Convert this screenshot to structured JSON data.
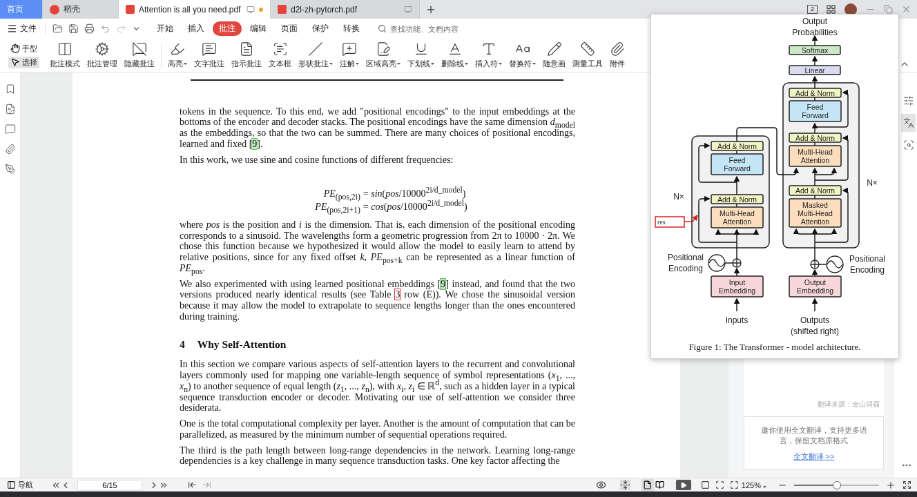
{
  "tabs": [
    {
      "kind": "home",
      "label": "首页",
      "selected": false,
      "unsaved": false
    },
    {
      "kind": "app",
      "label": "稻壳",
      "selected": false,
      "unsaved": false
    },
    {
      "kind": "pdf",
      "label": "Attention is all you need.pdf",
      "selected": true,
      "unsaved": true
    },
    {
      "kind": "pdf",
      "label": "d2l-zh-pytorch.pdf",
      "selected": false,
      "unsaved": false
    }
  ],
  "window_controls": {
    "screen_count": "2"
  },
  "menu": {
    "file": "文件",
    "search_placeholder": "查找功能、文档内容",
    "tabs": [
      {
        "label": "开始",
        "selected": false
      },
      {
        "label": "插入",
        "selected": false
      },
      {
        "label": "批注",
        "selected": true
      },
      {
        "label": "编辑",
        "selected": false
      },
      {
        "label": "页面",
        "selected": false
      },
      {
        "label": "保护",
        "selected": false
      },
      {
        "label": "转换",
        "selected": false
      }
    ]
  },
  "modes": [
    {
      "kind": "hand",
      "label": "手型",
      "selected": false
    },
    {
      "kind": "select",
      "label": "选择",
      "selected": true
    }
  ],
  "tools": [
    {
      "label": "批注模式",
      "dropdown": false
    },
    {
      "label": "批注管理",
      "dropdown": false
    },
    {
      "label": "隐藏批注",
      "dropdown": false
    },
    {
      "label": "高亮",
      "dropdown": true
    },
    {
      "label": "文字批注",
      "dropdown": false
    },
    {
      "label": "指示批注",
      "dropdown": false
    },
    {
      "label": "文本框",
      "dropdown": false
    },
    {
      "label": "形状批注",
      "dropdown": true
    },
    {
      "label": "注解",
      "dropdown": true
    },
    {
      "label": "区域高亮",
      "dropdown": true
    },
    {
      "label": "下划线",
      "dropdown": true
    },
    {
      "label": "删除线",
      "dropdown": true
    },
    {
      "label": "插入符",
      "dropdown": true
    },
    {
      "label": "替换符",
      "dropdown": true
    },
    {
      "label": "随意画",
      "dropdown": false
    },
    {
      "label": "测量工具",
      "dropdown": false
    },
    {
      "label": "附件",
      "dropdown": false
    }
  ],
  "document": {
    "blocks": [
      {
        "kind": "paragraph",
        "parts": [
          {
            "kind": "text",
            "text": "tokens in the sequence. To this end, we add \"positional encodings\" to the input embeddings at the bottoms of the encoder and decoder stacks. The positional encodings have the same dimension *d*$_{model}$ as the embeddings, so that the two can be summed. There are many choices of positional encodings, learned and fixed ["
          },
          {
            "kind": "cite",
            "text": "9"
          },
          {
            "kind": "text",
            "text": "]."
          }
        ]
      },
      {
        "kind": "paragraph",
        "parts": [
          {
            "kind": "text",
            "text": "In this work, we use sine and cosine functions of different frequencies:"
          }
        ]
      },
      {
        "kind": "formula",
        "rows": [
          {
            "lhs": "*PE*$_{(pos,2i)}$",
            "rhs": "= *sin*(*pos*/10000$^{2i/d_model}$)"
          },
          {
            "lhs": "*PE*$_{(pos,2i+1)}$",
            "rhs": "= *cos*(*pos*/10000$^{2i/d_model}$)"
          }
        ]
      },
      {
        "kind": "paragraph",
        "parts": [
          {
            "kind": "text",
            "text": "where *pos* is the position and *i* is the dimension. That is, each dimension of the positional encoding corresponds to a sinusoid. The wavelengths form a geometric progression from 2π to 10000 · 2π. We chose this function because we hypothesized it would allow the model to easily learn to attend by relative positions, since for any fixed offset *k*, *PE*$_{pos+k}$ can be represented as a linear function of *PE*$_{pos}$."
          }
        ]
      },
      {
        "kind": "paragraph",
        "parts": [
          {
            "kind": "text",
            "text": "We also experimented with using learned positional embeddings ["
          },
          {
            "kind": "cite",
            "text": "9"
          },
          {
            "kind": "text",
            "text": "] instead, and found that the two versions produced nearly identical results (see Table "
          },
          {
            "kind": "ref",
            "text": "3"
          },
          {
            "kind": "text",
            "text": " row (E)). We chose the sinusoidal version because it may allow the model to extrapolate to sequence lengths longer than the ones encountered during training."
          }
        ]
      },
      {
        "kind": "heading",
        "number": "4",
        "title": "Why Self-Attention"
      },
      {
        "kind": "paragraph",
        "parts": [
          {
            "kind": "text",
            "text": "In this section we compare various aspects of self-attention layers to the recurrent and convolutional layers commonly used for mapping one variable-length sequence of symbol representations (*x*$_{1}$, ..., *x*$_{n}$) to another sequence of equal length (*z*$_{1}$, ..., *z*$_{n}$), with *x*$_{i}$, *z*$_{i}$ ∈ ℝ$^{d}$, such as a hidden layer in a typical sequence transduction encoder or decoder. Motivating our use of self-attention we consider three desiderata."
          }
        ]
      },
      {
        "kind": "paragraph",
        "parts": [
          {
            "kind": "text",
            "text": "One is the total computational complexity per layer. Another is the amount of computation that can be parallelized, as measured by the minimum number of sequential operations required."
          }
        ]
      },
      {
        "kind": "paragraph",
        "parts": [
          {
            "kind": "text",
            "text": "The third is the path length between long-range dependencies in the network. Learning long-range dependencies is a key challenge in many sequence transduction tasks. One key factor affecting the"
          }
        ]
      }
    ]
  },
  "figure": {
    "blocks": [
      {
        "kind": "softmax",
        "lines": [
          "Softmax"
        ]
      },
      {
        "kind": "linear",
        "lines": [
          "Linear"
        ]
      },
      {
        "kind": "add_norm",
        "lines": [
          "Add & Norm"
        ]
      },
      {
        "kind": "feed_forward",
        "lines": [
          "Feed",
          "Forward"
        ]
      },
      {
        "kind": "add_norm",
        "lines": [
          "Add & Norm"
        ]
      },
      {
        "kind": "add_norm",
        "lines": [
          "Add & Norm"
        ]
      },
      {
        "kind": "attention",
        "lines": [
          "Multi-Head",
          "Attention"
        ]
      },
      {
        "kind": "feed_forward",
        "lines": [
          "Feed",
          "Forward"
        ]
      },
      {
        "kind": "add_norm",
        "lines": [
          "Add & Norm"
        ]
      },
      {
        "kind": "add_norm",
        "lines": [
          "Add & Norm"
        ]
      },
      {
        "kind": "attention",
        "lines": [
          "Multi-Head",
          "Attention"
        ]
      },
      {
        "kind": "attention",
        "lines": [
          "Masked",
          "Multi-Head",
          "Attention"
        ]
      },
      {
        "kind": "embedding",
        "lines": [
          "Input",
          "Embedding"
        ]
      },
      {
        "kind": "embedding",
        "lines": [
          "Output",
          "Embedding"
        ]
      }
    ],
    "labels": [
      {
        "lines": [
          "Output",
          "Probabilities"
        ]
      },
      {
        "lines": [
          "N×"
        ]
      },
      {
        "lines": [
          "N×"
        ]
      },
      {
        "lines": [
          "Positional",
          "Encoding"
        ]
      },
      {
        "lines": [
          "Positional",
          "Encoding"
        ]
      },
      {
        "lines": [
          "Inputs"
        ]
      },
      {
        "lines": [
          "Outputs",
          "(shifted right)"
        ]
      }
    ],
    "annotation": "res",
    "caption": "Figure 1: The Transformer - model architecture."
  },
  "translation": {
    "source": "翻译来源：金山词霸",
    "promo": "邀你使用全文翻译，支持更多语言，保留文档原格式",
    "link": "全文翻译 >>"
  },
  "right_rail": [
    {
      "kind": "sliders",
      "selected": false
    },
    {
      "kind": "translate",
      "selected": true
    },
    {
      "kind": "search",
      "selected": false
    }
  ],
  "status_bar": {
    "nav": "导航",
    "page": "6/15",
    "view_modes": [
      {
        "kind": "single",
        "selected": true
      },
      {
        "kind": "double",
        "selected": false
      }
    ],
    "zoom": "125%",
    "zoom_slider": {
      "level": 0.5
    }
  }
}
